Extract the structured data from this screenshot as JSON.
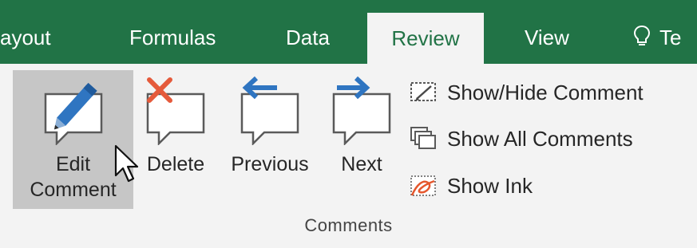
{
  "colors": {
    "ribbon_green": "#217346",
    "ribbon_bg": "#f3f3f3",
    "hover_gray": "#c6c6c6",
    "arrow_blue": "#2f75c1",
    "delete_red": "#e55a3b",
    "ink_orange": "#e5572d"
  },
  "tabs": [
    {
      "label": "ayout",
      "active": false
    },
    {
      "label": "Formulas",
      "active": false
    },
    {
      "label": "Data",
      "active": false
    },
    {
      "label": "Review",
      "active": true
    },
    {
      "label": "View",
      "active": false
    },
    {
      "label": "Te",
      "active": false,
      "icon": "lightbulb-icon"
    }
  ],
  "comments_group": {
    "label": "Comments",
    "edit_comment": {
      "line1": "Edit",
      "line2": "Comment",
      "icon": "edit-comment-icon"
    },
    "delete": {
      "label": "Delete",
      "icon": "delete-comment-icon"
    },
    "previous": {
      "label": "Previous",
      "icon": "previous-comment-icon"
    },
    "next": {
      "label": "Next",
      "icon": "next-comment-icon"
    },
    "show_hide_comment": {
      "label": "Show/Hide Comment",
      "icon": "show-hide-comment-icon"
    },
    "show_all_comments": {
      "label": "Show All Comments",
      "icon": "show-all-comments-icon"
    },
    "show_ink": {
      "label": "Show Ink",
      "icon": "show-ink-icon"
    }
  }
}
